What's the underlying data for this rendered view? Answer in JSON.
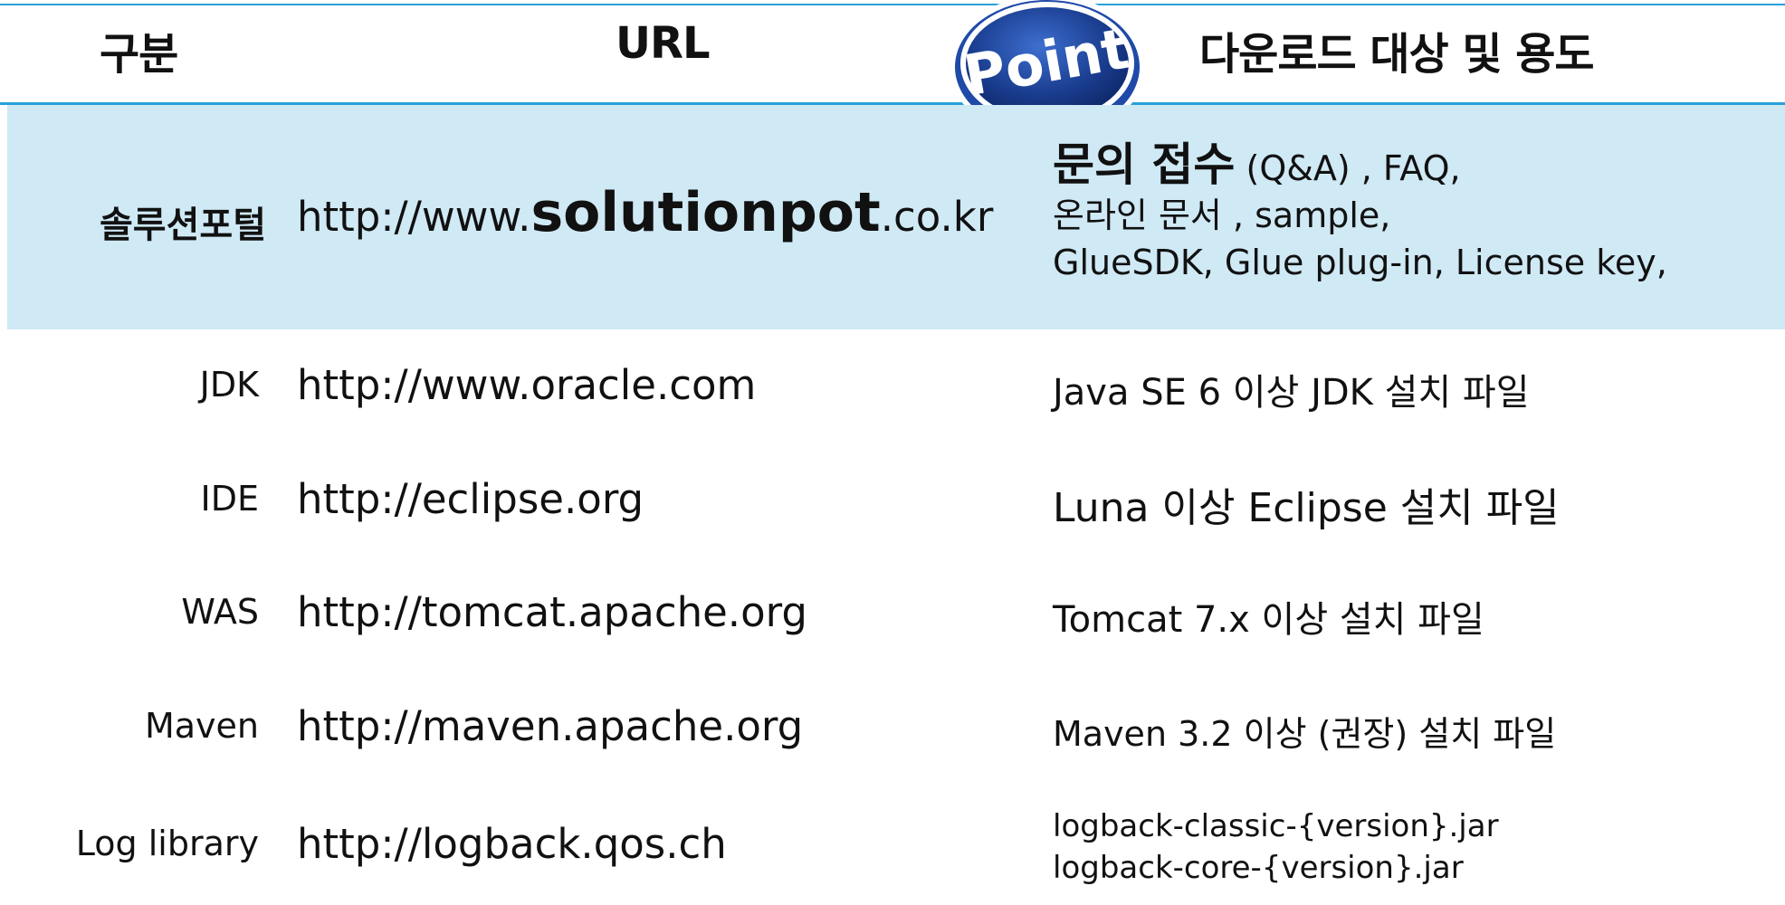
{
  "header": {
    "category": "구분",
    "url": "URL",
    "download": "다운로드 대상 및 용도"
  },
  "badge": {
    "label": "Point"
  },
  "rows": [
    {
      "category": "솔루션포털",
      "url_prefix": "http://www.",
      "url_main": "solutionpot",
      "url_suffix": ".co.kr",
      "download_bold": "문의 접수",
      "download_line1_rest": " (Q&A) , FAQ,",
      "download_line2": "온라인 문서 , sample,",
      "download_line3": "GlueSDK, Glue plug-in, License key,"
    },
    {
      "category": "JDK",
      "url": "http://www.oracle.com",
      "download": "Java SE 6 이상 JDK 설치 파일"
    },
    {
      "category": "IDE",
      "url": "http://eclipse.org",
      "download": "Luna 이상 Eclipse 설치 파일"
    },
    {
      "category": "WAS",
      "url": "http://tomcat.apache.org",
      "download": "Tomcat 7.x 이상 설치 파일"
    },
    {
      "category": "Maven",
      "url": "http://maven.apache.org",
      "download": "Maven 3.2 이상 (권장) 설치 파일"
    },
    {
      "category": "Log library",
      "url": "http://logback.qos.ch",
      "download_line1": "logback-classic-{version}.jar",
      "download_line2": "logback-core-{version}.jar"
    }
  ],
  "colors": {
    "accent": "#2a9fd8",
    "highlight": "#cfe9f5",
    "badge": "#1a3d8f"
  }
}
